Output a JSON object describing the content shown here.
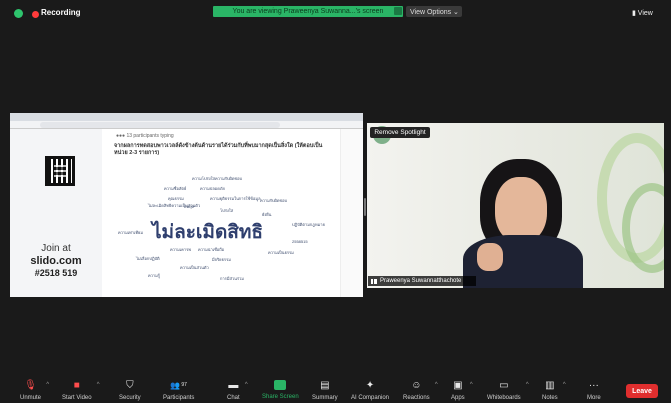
{
  "top_bar": {
    "recording_label": "Recording",
    "banner_text": "You are viewing Praweenya Suwanna...'s screen",
    "view_options_label": "View Options ⌄",
    "view_label": "View"
  },
  "share": {
    "slido": {
      "join_line1": "Join at",
      "join_line2": "slido.com",
      "join_line3": "#2518 519",
      "participants": "●●● 13 participants typing",
      "question": "จากผลการทดสอบพาวเวลล์ดังข้างต้นด้านรายได้ร่วมกับที่พบมากสุดเป็นสิ่งใด (ให้ตอบเป็นหน่วย 2-3 รายการ)",
      "cloud_big": "ไม่ละเมิดสิทธิ",
      "cloud_words": [
        "ความโปร่งใสความรับผิดชอบ",
        "ความซื่อสัตย์",
        "ความปลอดภัย",
        "คุณธรรม",
        "ความยุติธรรมในการใช้ข้อมูล",
        "ไม่ละเมิดสิทธิความเป็นส่วนตัว",
        "สมดุล",
        "ความรับผิดชอบ",
        "โปร่งใส",
        "ความเท่าเทียม",
        "ปฏิบัติตามกฎหมาย",
        "ความเคารพ",
        "ความน่าเชื่อถือ",
        "ความเป็นธรรม",
        "2558515",
        "ไม่เลือกปฏิบัติ",
        "มีจริยธรรม",
        "ความเป็นส่วนตัว",
        "ความรู้",
        "การมีส่วนร่วม",
        "ยั่งยืน"
      ]
    }
  },
  "video": {
    "remove_spotlight": "Remove Spotlight",
    "participant_name": "Praweenya Suwannatthachote"
  },
  "toolbar": {
    "items": [
      {
        "label": "Unmute",
        "icon": "mic-muted-icon"
      },
      {
        "label": "Start Video",
        "icon": "video-off-icon"
      },
      {
        "label": "Security",
        "icon": "shield-icon"
      },
      {
        "label": "Participants",
        "icon": "participants-icon",
        "count": "97"
      },
      {
        "label": "Chat",
        "icon": "chat-icon"
      },
      {
        "label": "Share Screen",
        "icon": "share-screen-icon"
      },
      {
        "label": "Summary",
        "icon": "summary-icon"
      },
      {
        "label": "AI Companion",
        "icon": "ai-companion-icon"
      },
      {
        "label": "Reactions",
        "icon": "reactions-icon"
      },
      {
        "label": "Apps",
        "icon": "apps-icon"
      },
      {
        "label": "Whiteboards",
        "icon": "whiteboards-icon"
      },
      {
        "label": "Notes",
        "icon": "notes-icon"
      },
      {
        "label": "More",
        "icon": "more-icon"
      }
    ],
    "leave_label": "Leave"
  },
  "colors": {
    "accent_green": "#2ab566",
    "leave_red": "#e02e2e",
    "recording_red": "#ff3b3b"
  }
}
